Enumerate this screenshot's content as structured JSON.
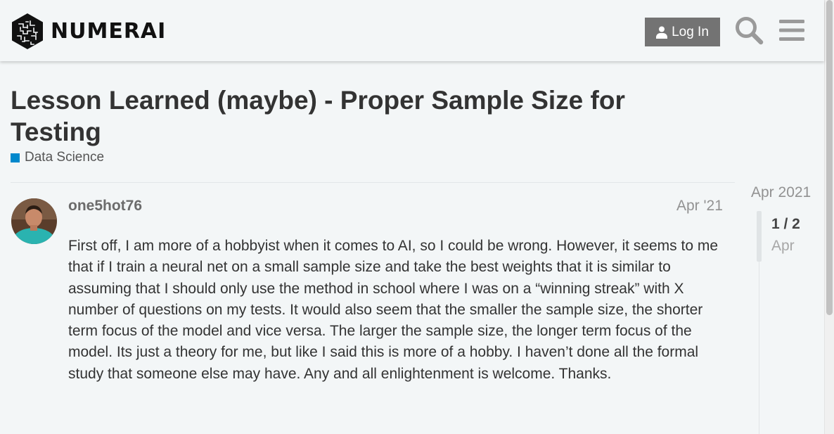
{
  "header": {
    "brand": "NUMERAI",
    "login_label": "Log In",
    "icons": {
      "logo": "numerai-logo-icon",
      "user": "user-icon",
      "search": "search-icon",
      "menu": "hamburger-menu-icon"
    }
  },
  "topic": {
    "title": "Lesson Learned (maybe) - Proper Sample Size for Testing",
    "category": "Data Science",
    "category_color": "#0088cc"
  },
  "post": {
    "username": "one5hot76",
    "date": "Apr '21",
    "body": "First off, I am more of a hobbyist when it comes to AI, so I could be wrong. However, it seems to me that if I train a neural net on a small sample size and take the best weights that it is similar to assuming that I should only use the method in school where I was on a “winning streak” with X number of questions on my tests. It would also seem that the smaller the sample size, the shorter term focus of the model and vice versa. The larger the sample size, the longer term focus of the model. Its just a theory for me, but like I said this is more of a hobby. I haven’t done all the formal study that someone else may have. Any and all enlightenment is welcome. Thanks."
  },
  "timeline": {
    "start_date": "Apr 2021",
    "position": "1 / 2",
    "current_month": "Apr"
  },
  "colors": {
    "background": "#f3f6f7",
    "button": "#737373",
    "accent": "#0088cc"
  }
}
